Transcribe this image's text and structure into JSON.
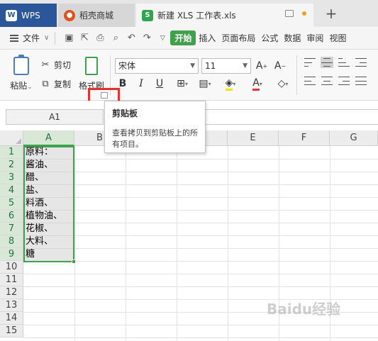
{
  "tabs": [
    {
      "label": "WPS",
      "icon": "wps-logo-icon"
    },
    {
      "label": "稻壳商城",
      "icon": "docer-icon"
    },
    {
      "label": "新建 XLS 工作表.xls",
      "icon": "spreadsheet-icon"
    }
  ],
  "menubar": {
    "file_label": "文件",
    "tabs": [
      "开始",
      "插入",
      "页面布局",
      "公式",
      "数据",
      "审阅",
      "视图"
    ],
    "active_tab": "开始",
    "accent": "#3fa14b"
  },
  "ribbon": {
    "paste_label": "粘贴",
    "cut_label": "剪切",
    "copy_label": "复制",
    "format_painter_label": "格式刷",
    "font_name": "宋体",
    "font_size": "11",
    "bold": "B",
    "italic": "I",
    "underline": "U"
  },
  "formula_bar": {
    "name_box": "A1",
    "content": ":"
  },
  "tooltip": {
    "title": "剪贴板",
    "description": "查看拷贝到剪贴板上的所有项目。"
  },
  "sheet": {
    "columns": [
      "A",
      "B",
      "C",
      "D",
      "E",
      "F",
      "G"
    ],
    "rows": [
      "1",
      "2",
      "3",
      "4",
      "5",
      "6",
      "7",
      "8",
      "9",
      "10",
      "11",
      "12",
      "13",
      "14",
      "15"
    ],
    "cells_A": [
      "原料：",
      "酱油、",
      "醋、",
      "盐、",
      "料酒、",
      "植物油、",
      "花椒、",
      "大料、",
      "糖"
    ]
  },
  "watermark": "Baidu经验"
}
